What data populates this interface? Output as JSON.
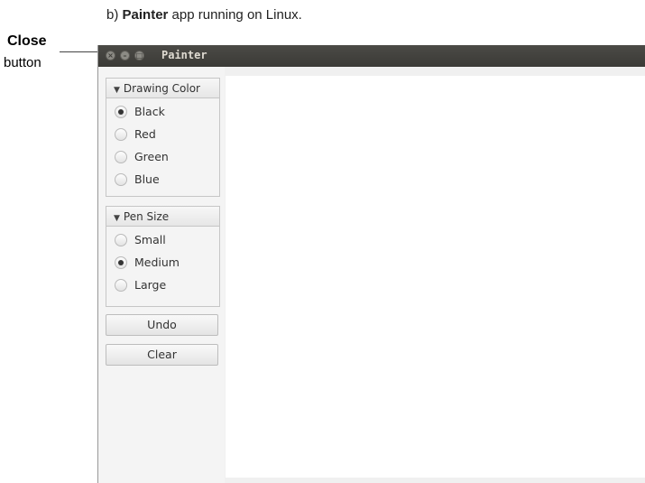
{
  "caption": {
    "prefix": "b) ",
    "app_name": "Painter",
    "suffix": " app running on Linux."
  },
  "callout": {
    "title": "Close",
    "sub": "button"
  },
  "window": {
    "title": "Painter"
  },
  "drawing_color": {
    "header": "Drawing Color",
    "options": [
      "Black",
      "Red",
      "Green",
      "Blue"
    ],
    "selected": "Black"
  },
  "pen_size": {
    "header": "Pen Size",
    "options": [
      "Small",
      "Medium",
      "Large"
    ],
    "selected": "Medium"
  },
  "buttons": {
    "undo": "Undo",
    "clear": "Clear"
  },
  "icons": {
    "collapse": "triangle-down-icon",
    "close": "close-icon",
    "minimize": "minimize-icon",
    "maximize": "maximize-icon"
  }
}
